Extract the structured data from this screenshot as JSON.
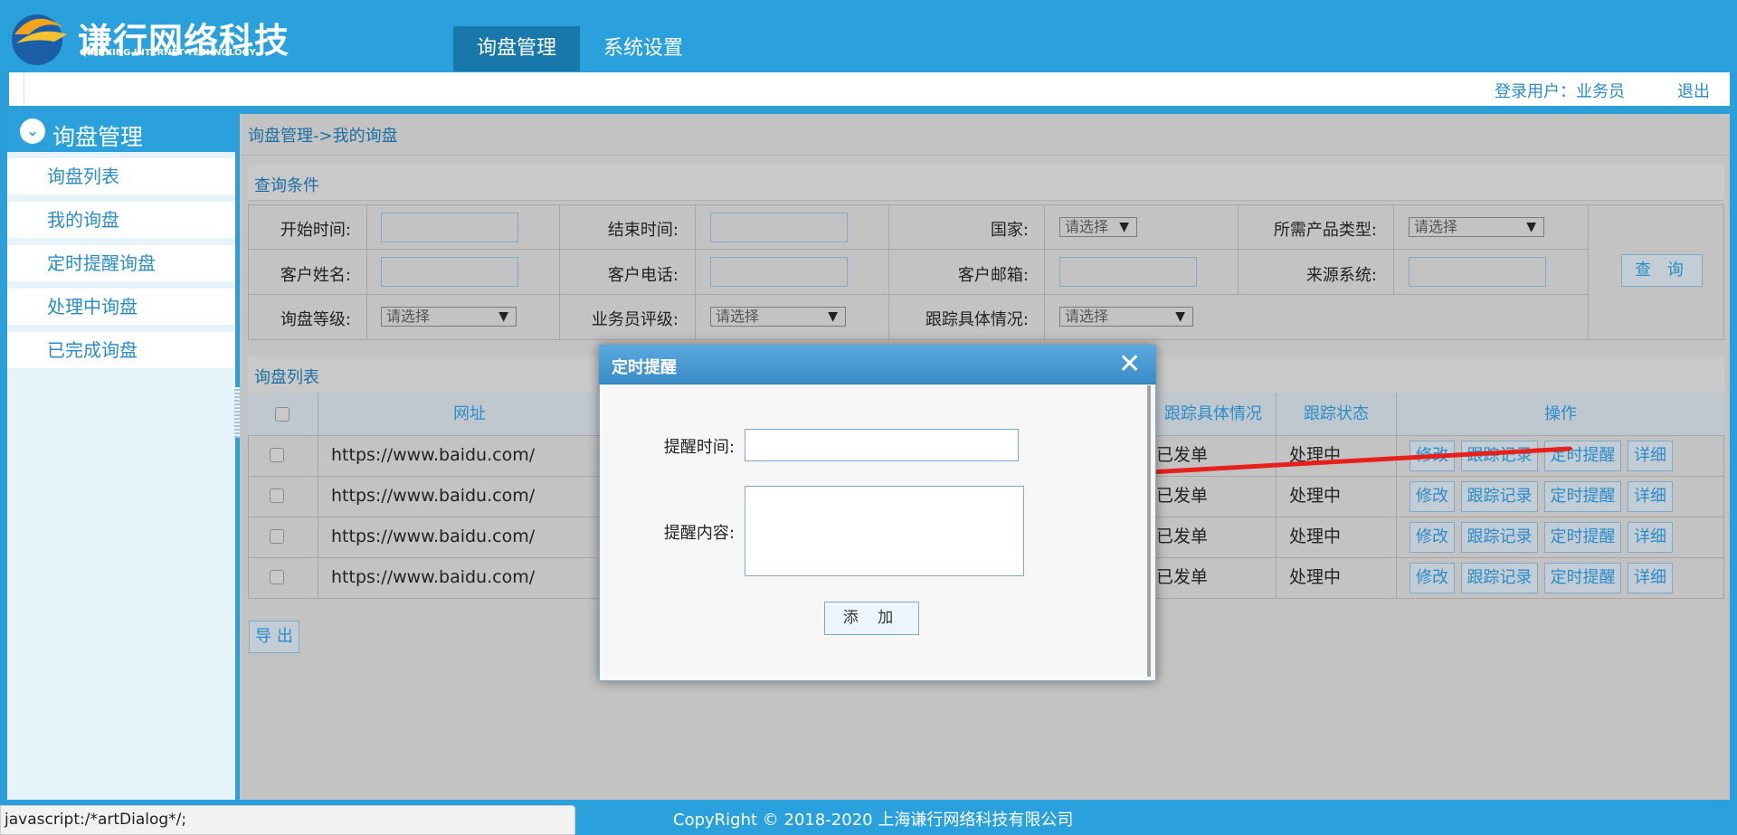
{
  "header": {
    "logo_text": "谦行网络科技",
    "logo_subtext": "QIANXING INTERNET TECHNOLOGY",
    "tabs": [
      "询盘管理",
      "系统设置"
    ],
    "user_label": "登录用户：业务员",
    "logout": "退出"
  },
  "sidebar": {
    "title": "询盘管理",
    "items": [
      "询盘列表",
      "我的询盘",
      "定时提醒询盘",
      "处理中询盘",
      "已完成询盘"
    ]
  },
  "breadcrumb": "询盘管理->我的询盘",
  "query": {
    "title": "查询条件",
    "labels": {
      "start_time": "开始时间:",
      "end_time": "结束时间:",
      "country": "国家:",
      "product_type": "所需产品类型:",
      "customer_name": "客户姓名:",
      "customer_phone": "客户电话:",
      "customer_email": "客户邮箱:",
      "source_system": "来源系统:",
      "inquiry_level": "询盘等级:",
      "sales_rating": "业务员评级:",
      "tracking_detail": "跟踪具体情况:"
    },
    "select_placeholder": "请选择",
    "search_button": "查 询"
  },
  "list": {
    "title": "询盘列表",
    "columns": [
      "网址",
      "跟踪具体情况",
      "跟踪状态",
      "操作"
    ],
    "rows": [
      {
        "url": "https://www.baidu.com/",
        "tracking_detail": "已发单",
        "status": "处理中"
      },
      {
        "url": "https://www.baidu.com/",
        "tracking_detail": "已发单",
        "status": "处理中"
      },
      {
        "url": "https://www.baidu.com/",
        "tracking_detail": "已发单",
        "status": "处理中"
      },
      {
        "url": "https://www.baidu.com/",
        "tracking_detail": "已发单",
        "status": "处理中"
      }
    ],
    "actions": [
      "修改",
      "跟踪记录",
      "定时提醒",
      "详细"
    ],
    "export_button": "导 出"
  },
  "dialog": {
    "title": "定时提醒",
    "time_label": "提醒时间:",
    "content_label": "提醒内容:",
    "add_button": "添 加"
  },
  "footer": {
    "copyright": "CopyRight © 2018-2020 上海谦行网络科技有限公司",
    "status_url": "javascript:/*artDialog*/;"
  },
  "colors": {
    "brand_blue": "#2aa0dc",
    "active_tab": "#1878ac",
    "link_blue": "#2a8cc8",
    "arrow_red": "#e8201c"
  }
}
